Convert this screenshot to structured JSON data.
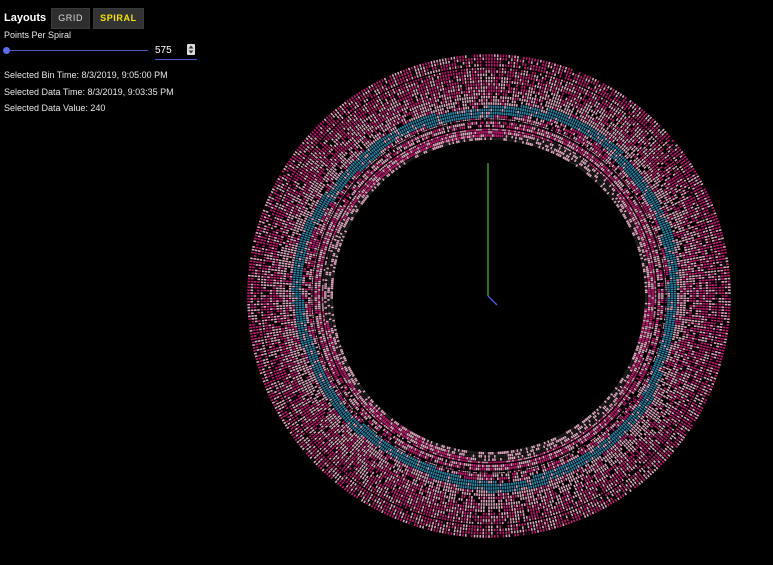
{
  "panel": {
    "layouts_label": "Layouts",
    "buttons": [
      {
        "label": "GRID",
        "active": false
      },
      {
        "label": "SPIRAL",
        "active": true
      }
    ],
    "points_per_spiral_label": "Points Per Spiral",
    "points_per_spiral_value": "575",
    "slider_fraction": 0.0,
    "selected_bin_time": "Selected Bin Time: 8/3/2019, 9:05:00 PM",
    "selected_data_time": "Selected Data Time: 8/3/2019, 9:03:35 PM",
    "selected_data_value": "Selected Data Value: 240"
  },
  "colors": {
    "accent_yellow": "#f5e400",
    "slider_blue": "#4a56c8",
    "magenta": "#c0186f",
    "pink": "#e0a8c0",
    "teal": "#2a86a8",
    "axis_x": "#e8231c",
    "axis_x_end": "#f5c800",
    "axis_y": "#3fa82a",
    "axis_z": "#4a5cf0"
  }
}
